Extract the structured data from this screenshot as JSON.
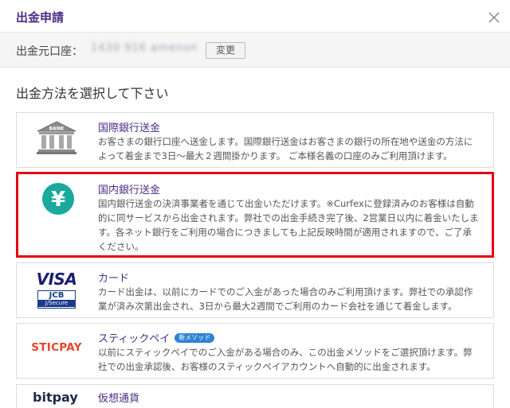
{
  "dialog": {
    "title": "出金申請",
    "close_icon": "close-icon"
  },
  "account": {
    "label": "出金元口座：",
    "masked_value": "1430 916  amenon",
    "change_label": "変更"
  },
  "section_title": "出金方法を選択して下さい",
  "methods": [
    {
      "name": "国際銀行送金",
      "icon": "bank-icon",
      "description": "お客さまの銀行口座へ送金します。国際銀行送金はお客さまの銀行の所在地や送金の方法によって着金まで3日〜最大２週間掛かります。 ご本様名義の口座のみご利用頂けます。",
      "icon_label": "BANK"
    },
    {
      "name": "国内銀行送金",
      "icon": "yen-icon",
      "selected": true,
      "icon_symbol": "¥",
      "description": "国内銀行送金の決済事業者を通じて出金いただけます。※Curfexに登録済みのお客様は自動的に同サービスから出金されます。弊社での出金手続き完了後、2営業日以内に着金いたします。各ネット銀行をご利用の場合につきましても上記反映時間が適用されますので、ご了承ください。"
    },
    {
      "name": "カード",
      "icon": "visa-jcb-icon",
      "logo_visa": "VISA",
      "logo_jcb": "JCB",
      "logo_jcb_sub": "J/Secure",
      "description": "カード出金は、以前にカードでのご入金があった場合のみご利用頂けます。弊社での承認作業が済み次第出金され、3日から最大2週間でご利用のカード会社を通じて着金します。"
    },
    {
      "name": "スティックペイ",
      "icon": "sticpay-icon",
      "logo_text": "STICPAY",
      "badge": "新メソッド",
      "description": "以前にスティックペイでのご入金がある場合のみ、この出金メソッドをご選択頂けます。弊社での出金承認後、お客様のスティックペイアカウントへ自動的に出金されます。"
    },
    {
      "name": "仮想通貨",
      "icon": "bitpay-icon",
      "logo_text": "bitpay"
    }
  ],
  "colors": {
    "accent_purple": "#4a2d86",
    "selected_border": "#e60012",
    "yen_teal": "#1aa99b",
    "sticpay_red": "#e2452d",
    "visa_blue": "#1a1f71"
  }
}
